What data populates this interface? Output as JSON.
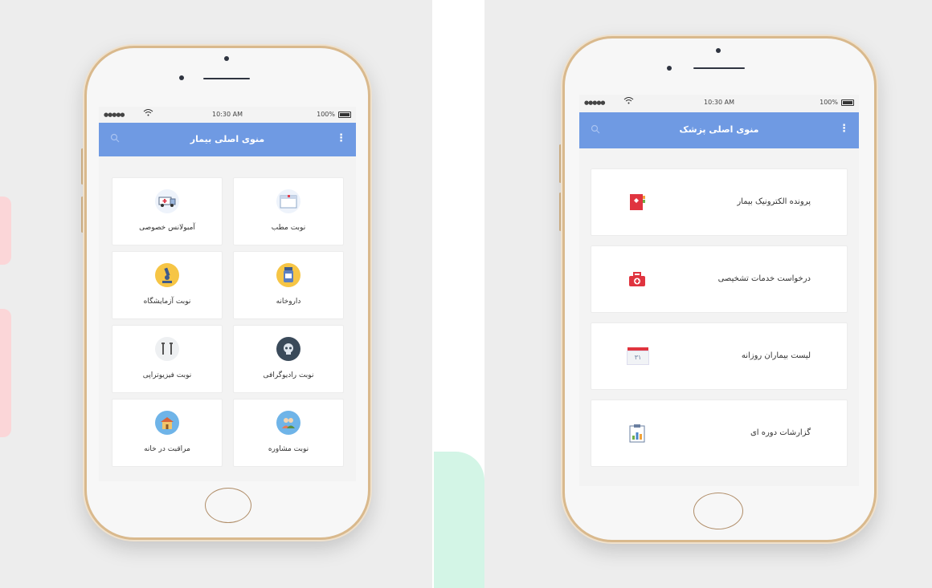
{
  "colors": {
    "appbar": "#6f9ae3",
    "phone_frame": "#d9b98d",
    "background": "#ededed"
  },
  "patient_phone": {
    "status": {
      "signal": "●●●●●",
      "wifi_icon": "wifi-icon",
      "time": "10:30 AM",
      "battery": "100%"
    },
    "appbar": {
      "title": "منوی اصلی بیمار",
      "search_icon": "search-icon",
      "menu_icon": "more-vertical-icon"
    },
    "items": [
      {
        "label": "نوبت مطب",
        "icon": "calendar-icon"
      },
      {
        "label": "آمبولانس خصوصی",
        "icon": "ambulance-icon"
      },
      {
        "label": "داروخانه",
        "icon": "pill-bottle-icon"
      },
      {
        "label": "نوبت آزمایشگاه",
        "icon": "microscope-icon"
      },
      {
        "label": "نوبت رادیوگرافی",
        "icon": "skull-xray-icon"
      },
      {
        "label": "نوبت فیزیوتراپی",
        "icon": "crutches-icon"
      },
      {
        "label": "نوبت مشاوره",
        "icon": "people-icon"
      },
      {
        "label": "مراقبت در خانه",
        "icon": "house-icon"
      }
    ]
  },
  "doctor_phone": {
    "status": {
      "signal": "●●●●●",
      "wifi_icon": "wifi-icon",
      "time": "10:30 AM",
      "battery": "100%"
    },
    "appbar": {
      "title": "منوی اصلی پزشک",
      "search_icon": "search-icon",
      "menu_icon": "more-vertical-icon"
    },
    "items": [
      {
        "label": "پرونده الکترونیک بیمار",
        "icon": "medical-folder-icon"
      },
      {
        "label": "درخواست خدمات تشخیصی",
        "icon": "first-aid-kit-icon"
      },
      {
        "label": "لیست بیماران روزانه",
        "icon": "calendar-icon",
        "badge": "۳۱"
      },
      {
        "label": "گزارشات دوره ای",
        "icon": "report-chart-icon"
      }
    ]
  }
}
